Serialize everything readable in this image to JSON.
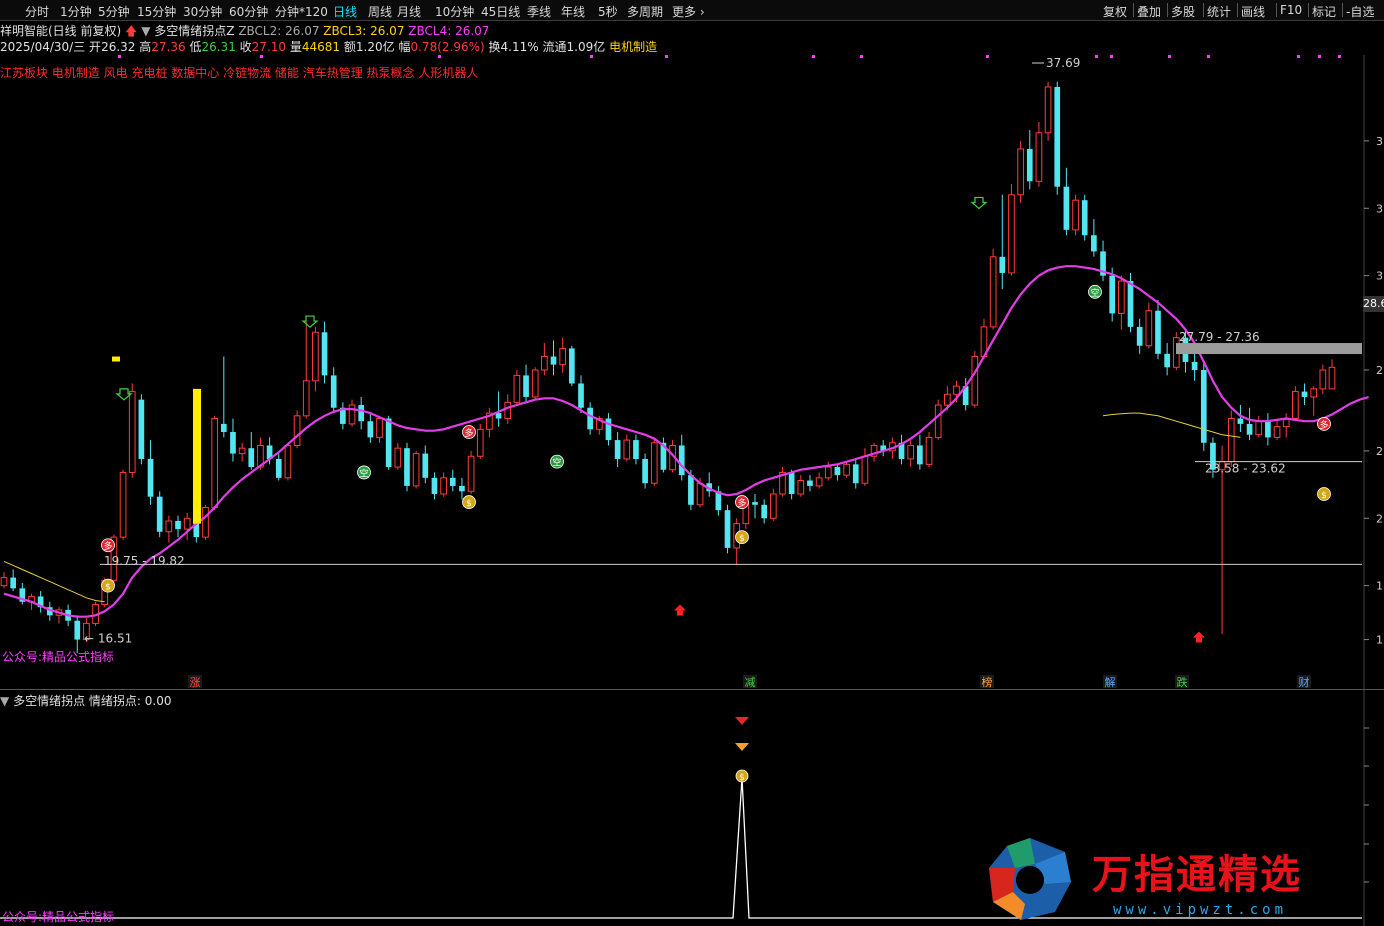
{
  "toolbar": {
    "periods": [
      "分时",
      "1分钟",
      "5分钟",
      "15分钟",
      "30分钟",
      "60分钟",
      "分钟*120",
      "日线",
      "周线",
      "月线",
      "10分钟",
      "45日线",
      "季线",
      "年线",
      "5秒",
      "多周期",
      "更多"
    ],
    "active_period": "日线",
    "right_buttons": [
      "复权",
      "叠加",
      "多股",
      "统计",
      "画线",
      "F10",
      "标记",
      "-自选"
    ]
  },
  "header": {
    "stock": "祥明智能(日线 前复权)",
    "indicator": "多空情绪拐点Z",
    "zbcl2": "ZBCL2: 26.07",
    "zbcl3": "ZBCL3: 26.07",
    "zbcl4": "ZBCL4: 26.07"
  },
  "quote": {
    "date": "2025/04/30/三",
    "open_label": "开",
    "open": "26.32",
    "high_label": "高",
    "high": "27.36",
    "low_label": "低",
    "low": "26.31",
    "close_label": "收",
    "close": "27.10",
    "vol_label": "量",
    "vol": "44681",
    "amount_label": "额",
    "amount": "1.20亿",
    "range_label": "幅",
    "range": "0.78(2.96%)",
    "turnover_label": "换",
    "turnover": "4.11%",
    "float_label": "流通",
    "float": "1.09亿",
    "sector": "电机制造"
  },
  "concepts": "江苏板块 电机制造 风电 充电桩 数据中心 冷链物流 储能 汽车热管理 热泵概念 人形机器人",
  "annotations": {
    "peak": "37.69",
    "low": "16.51",
    "range_a": "19.75 - 19.82",
    "range_b": "27.79 - 27.36",
    "range_c": "23.58 - 23.62",
    "price_tag": "28.6",
    "right_ticks": [
      "3",
      "3",
      "3",
      "2",
      "2",
      "2",
      "1",
      "1"
    ]
  },
  "event_labels": [
    "涨",
    "减",
    "榜",
    "解",
    "跌",
    "财"
  ],
  "markers": [
    "多",
    "空",
    "$"
  ],
  "footer_mark": "公众号:精品公式指标",
  "sub": {
    "title": "多空情绪拐点",
    "value": "情绪拐点: 0.00"
  },
  "watermark": {
    "cn": "万指通精选",
    "url": "www.vipwzt.com"
  },
  "colors": {
    "up": "#ff3b3b",
    "down": "#54e6f0",
    "ma_main": "#e23ee8",
    "ma_yellow": "#e6d23a",
    "ma_white": "#9a9a9a",
    "accent": "#00e5ff"
  },
  "chart_data": {
    "type": "candlestick",
    "price_range": [
      15.5,
      38.5
    ],
    "candles": [
      [
        19.0,
        19.5,
        18.9,
        19.3
      ],
      [
        19.3,
        19.6,
        18.8,
        18.9
      ],
      [
        18.9,
        19.1,
        18.3,
        18.4
      ],
      [
        18.4,
        18.7,
        18.1,
        18.6
      ],
      [
        18.6,
        18.8,
        18.0,
        18.2
      ],
      [
        18.2,
        18.4,
        17.7,
        17.9
      ],
      [
        17.9,
        18.2,
        17.6,
        18.1
      ],
      [
        18.1,
        18.3,
        17.5,
        17.7
      ],
      [
        17.7,
        17.9,
        16.5,
        17.0
      ],
      [
        17.0,
        17.8,
        16.9,
        17.6
      ],
      [
        17.6,
        18.4,
        17.5,
        18.3
      ],
      [
        18.3,
        19.3,
        18.2,
        19.2
      ],
      [
        19.2,
        20.9,
        19.1,
        20.8
      ],
      [
        20.8,
        23.3,
        20.7,
        23.2
      ],
      [
        23.2,
        26.5,
        23.0,
        26.2
      ],
      [
        25.9,
        26.1,
        23.5,
        23.7
      ],
      [
        23.7,
        24.4,
        22.0,
        22.3
      ],
      [
        22.3,
        22.5,
        20.8,
        21.0
      ],
      [
        21.0,
        21.6,
        20.6,
        21.4
      ],
      [
        21.4,
        21.6,
        20.8,
        21.1
      ],
      [
        21.1,
        21.7,
        20.7,
        21.5
      ],
      [
        21.4,
        21.6,
        20.6,
        20.8
      ],
      [
        20.8,
        22.0,
        20.7,
        21.9
      ],
      [
        21.9,
        25.3,
        21.8,
        25.2
      ],
      [
        25.0,
        27.5,
        24.5,
        24.7
      ],
      [
        24.7,
        25.2,
        23.6,
        23.9
      ],
      [
        23.9,
        24.3,
        23.6,
        24.1
      ],
      [
        24.1,
        24.7,
        23.3,
        23.4
      ],
      [
        23.4,
        24.5,
        23.3,
        24.2
      ],
      [
        24.2,
        24.5,
        23.5,
        23.7
      ],
      [
        23.7,
        23.9,
        22.9,
        23.0
      ],
      [
        23.0,
        24.3,
        22.9,
        24.2
      ],
      [
        24.2,
        25.5,
        24.1,
        25.3
      ],
      [
        25.3,
        28.8,
        25.2,
        26.6
      ],
      [
        26.6,
        28.6,
        26.2,
        28.4
      ],
      [
        28.4,
        28.8,
        26.5,
        26.8
      ],
      [
        26.8,
        27.1,
        25.4,
        25.6
      ],
      [
        25.6,
        25.8,
        24.8,
        25.0
      ],
      [
        25.0,
        25.9,
        24.9,
        25.7
      ],
      [
        25.7,
        26.0,
        24.8,
        25.1
      ],
      [
        25.1,
        25.4,
        24.3,
        24.5
      ],
      [
        24.5,
        25.3,
        24.3,
        25.2
      ],
      [
        25.2,
        25.3,
        23.3,
        23.4
      ],
      [
        23.4,
        24.3,
        23.3,
        24.1
      ],
      [
        24.1,
        24.3,
        22.5,
        22.7
      ],
      [
        22.7,
        24.0,
        22.6,
        23.9
      ],
      [
        23.9,
        24.2,
        22.8,
        23.0
      ],
      [
        23.0,
        23.2,
        22.2,
        22.4
      ],
      [
        22.4,
        23.2,
        22.3,
        23.0
      ],
      [
        23.0,
        23.3,
        22.5,
        22.7
      ],
      [
        22.7,
        23.0,
        22.2,
        22.5
      ],
      [
        22.5,
        24.0,
        22.4,
        23.8
      ],
      [
        23.8,
        25.0,
        23.7,
        24.8
      ],
      [
        24.8,
        25.6,
        24.5,
        25.4
      ],
      [
        25.4,
        26.2,
        24.9,
        25.2
      ],
      [
        25.2,
        26.1,
        25.0,
        25.8
      ],
      [
        25.8,
        27.0,
        25.7,
        26.8
      ],
      [
        26.8,
        27.2,
        25.8,
        26.0
      ],
      [
        26.0,
        27.1,
        25.9,
        27.0
      ],
      [
        27.0,
        28.0,
        26.8,
        27.5
      ],
      [
        27.5,
        28.1,
        26.8,
        27.2
      ],
      [
        27.2,
        28.2,
        26.9,
        27.8
      ],
      [
        27.8,
        27.9,
        26.4,
        26.5
      ],
      [
        26.5,
        26.8,
        25.4,
        25.6
      ],
      [
        25.6,
        25.8,
        24.6,
        24.8
      ],
      [
        24.8,
        25.3,
        24.6,
        25.2
      ],
      [
        25.2,
        25.4,
        24.2,
        24.4
      ],
      [
        24.4,
        24.7,
        23.4,
        23.7
      ],
      [
        23.7,
        24.6,
        23.6,
        24.4
      ],
      [
        24.4,
        24.6,
        23.5,
        23.7
      ],
      [
        23.7,
        23.9,
        22.6,
        22.8
      ],
      [
        22.8,
        24.5,
        22.7,
        24.3
      ],
      [
        24.3,
        24.5,
        23.2,
        23.3
      ],
      [
        23.3,
        24.4,
        23.2,
        24.2
      ],
      [
        24.2,
        24.6,
        22.9,
        23.1
      ],
      [
        23.1,
        23.3,
        21.8,
        22.0
      ],
      [
        22.0,
        23.0,
        21.9,
        22.8
      ],
      [
        22.8,
        23.2,
        22.3,
        22.5
      ],
      [
        22.5,
        22.7,
        21.6,
        21.8
      ],
      [
        21.8,
        22.0,
        20.2,
        20.4
      ],
      [
        20.4,
        21.5,
        19.8,
        21.3
      ],
      [
        21.3,
        22.2,
        21.1,
        22.1
      ],
      [
        22.1,
        22.4,
        21.5,
        22.0
      ],
      [
        22.0,
        22.2,
        21.3,
        21.5
      ],
      [
        21.5,
        22.6,
        21.4,
        22.4
      ],
      [
        22.4,
        23.4,
        22.3,
        23.2
      ],
      [
        23.2,
        23.3,
        22.2,
        22.4
      ],
      [
        22.4,
        23.1,
        22.3,
        22.9
      ],
      [
        22.9,
        23.1,
        22.5,
        22.7
      ],
      [
        22.7,
        23.2,
        22.6,
        23.0
      ],
      [
        23.0,
        23.6,
        22.9,
        23.4
      ],
      [
        23.4,
        23.5,
        22.9,
        23.1
      ],
      [
        23.1,
        23.6,
        23.0,
        23.5
      ],
      [
        23.5,
        23.7,
        22.6,
        22.8
      ],
      [
        22.8,
        24.1,
        22.7,
        23.8
      ],
      [
        23.8,
        24.3,
        23.6,
        24.2
      ],
      [
        24.2,
        24.4,
        23.8,
        24.0
      ],
      [
        24.0,
        24.5,
        23.7,
        24.3
      ],
      [
        24.3,
        24.6,
        23.5,
        23.7
      ],
      [
        23.7,
        24.4,
        23.4,
        24.2
      ],
      [
        24.2,
        24.6,
        23.3,
        23.5
      ],
      [
        23.5,
        24.7,
        23.4,
        24.5
      ],
      [
        24.5,
        25.9,
        24.4,
        25.7
      ],
      [
        25.7,
        26.4,
        25.5,
        26.1
      ],
      [
        26.1,
        26.6,
        25.8,
        26.4
      ],
      [
        26.4,
        26.7,
        25.5,
        25.7
      ],
      [
        25.7,
        27.7,
        25.6,
        27.5
      ],
      [
        27.5,
        28.9,
        27.4,
        28.6
      ],
      [
        28.6,
        31.5,
        28.5,
        31.2
      ],
      [
        31.2,
        33.5,
        30.0,
        30.6
      ],
      [
        30.6,
        33.9,
        30.5,
        33.5
      ],
      [
        33.5,
        35.5,
        33.2,
        35.2
      ],
      [
        35.2,
        35.9,
        33.7,
        34.0
      ],
      [
        34.0,
        36.2,
        33.8,
        35.8
      ],
      [
        35.8,
        37.7,
        35.5,
        37.5
      ],
      [
        37.5,
        37.7,
        33.5,
        33.8
      ],
      [
        33.8,
        34.5,
        32.0,
        32.2
      ],
      [
        32.2,
        33.5,
        32.0,
        33.3
      ],
      [
        33.3,
        33.5,
        31.8,
        32.0
      ],
      [
        32.0,
        32.6,
        31.2,
        31.4
      ],
      [
        31.4,
        31.8,
        30.3,
        30.5
      ],
      [
        30.5,
        30.8,
        28.8,
        29.1
      ],
      [
        29.1,
        30.5,
        28.5,
        30.3
      ],
      [
        30.3,
        30.6,
        28.4,
        28.6
      ],
      [
        28.6,
        28.9,
        27.6,
        27.9
      ],
      [
        27.9,
        29.5,
        27.8,
        29.2
      ],
      [
        29.2,
        29.6,
        27.4,
        27.6
      ],
      [
        27.6,
        28.0,
        26.8,
        27.1
      ],
      [
        27.1,
        28.4,
        27.0,
        28.2
      ],
      [
        28.2,
        28.5,
        26.9,
        27.3
      ],
      [
        27.3,
        27.6,
        26.6,
        27.0
      ],
      [
        27.0,
        27.3,
        24.0,
        24.3
      ],
      [
        24.3,
        24.5,
        23.0,
        23.3
      ],
      [
        23.3,
        24.2,
        17.2,
        23.6
      ],
      [
        23.6,
        25.5,
        23.4,
        25.2
      ],
      [
        25.2,
        25.7,
        24.7,
        25.0
      ],
      [
        25.0,
        25.6,
        24.4,
        24.6
      ],
      [
        24.6,
        25.3,
        24.5,
        25.1
      ],
      [
        25.1,
        25.4,
        24.2,
        24.5
      ],
      [
        24.5,
        25.2,
        24.4,
        24.9
      ],
      [
        24.9,
        25.4,
        24.5,
        25.2
      ],
      [
        25.2,
        26.4,
        25.1,
        26.2
      ],
      [
        26.2,
        26.5,
        25.7,
        26.0
      ],
      [
        26.0,
        26.4,
        25.3,
        26.3
      ],
      [
        26.3,
        27.2,
        26.1,
        27.0
      ],
      [
        26.3,
        27.4,
        26.3,
        27.1
      ]
    ],
    "ma_main": [
      18.7,
      18.6,
      18.5,
      18.4,
      18.25,
      18.1,
      18.0,
      17.9,
      17.85,
      17.85,
      17.9,
      18.05,
      18.3,
      18.7,
      19.3,
      19.7,
      20.0,
      20.2,
      20.45,
      20.7,
      21.0,
      21.3,
      21.55,
      21.9,
      22.3,
      22.65,
      22.95,
      23.2,
      23.45,
      23.7,
      23.95,
      24.25,
      24.55,
      24.85,
      25.1,
      25.3,
      25.45,
      25.55,
      25.55,
      25.5,
      25.4,
      25.25,
      25.1,
      24.95,
      24.85,
      24.8,
      24.75,
      24.75,
      24.8,
      24.9,
      25.0,
      25.1,
      25.2,
      25.3,
      25.45,
      25.6,
      25.7,
      25.8,
      25.9,
      25.95,
      25.95,
      25.85,
      25.7,
      25.5,
      25.3,
      25.15,
      25.0,
      24.9,
      24.8,
      24.7,
      24.6,
      24.45,
      24.2,
      23.85,
      23.45,
      23.1,
      22.8,
      22.6,
      22.45,
      22.35,
      22.4,
      22.55,
      22.75,
      22.9,
      23.0,
      23.1,
      23.2,
      23.3,
      23.35,
      23.4,
      23.45,
      23.5,
      23.6,
      23.7,
      23.8,
      23.9,
      24.0,
      24.1,
      24.25,
      24.45,
      24.7,
      25.0,
      25.3,
      25.6,
      25.95,
      26.4,
      26.9,
      27.5,
      28.1,
      28.7,
      29.3,
      29.8,
      30.2,
      30.5,
      30.7,
      30.8,
      30.85,
      30.85,
      30.8,
      30.75,
      30.65,
      30.55,
      30.4,
      30.2,
      30.0,
      29.75,
      29.5,
      29.2,
      28.9,
      28.5,
      28.0,
      27.3,
      26.6,
      26.0,
      25.6,
      25.3,
      25.15,
      25.1,
      25.1,
      25.15,
      25.2,
      25.15,
      25.1,
      25.1,
      25.2,
      25.35,
      25.55,
      25.75,
      25.9,
      26.0
    ],
    "ma_yellow": [
      19.9,
      19.75,
      19.6,
      19.45,
      19.3,
      19.15,
      19.0,
      18.85,
      18.7,
      18.55,
      18.45,
      18.4
    ],
    "ma_yellow2": [
      25.3,
      25.35,
      25.38,
      25.4,
      25.4,
      25.35,
      25.3,
      25.2,
      25.1,
      25.0,
      24.9,
      24.8,
      24.7,
      24.6,
      24.55,
      24.5
    ]
  }
}
